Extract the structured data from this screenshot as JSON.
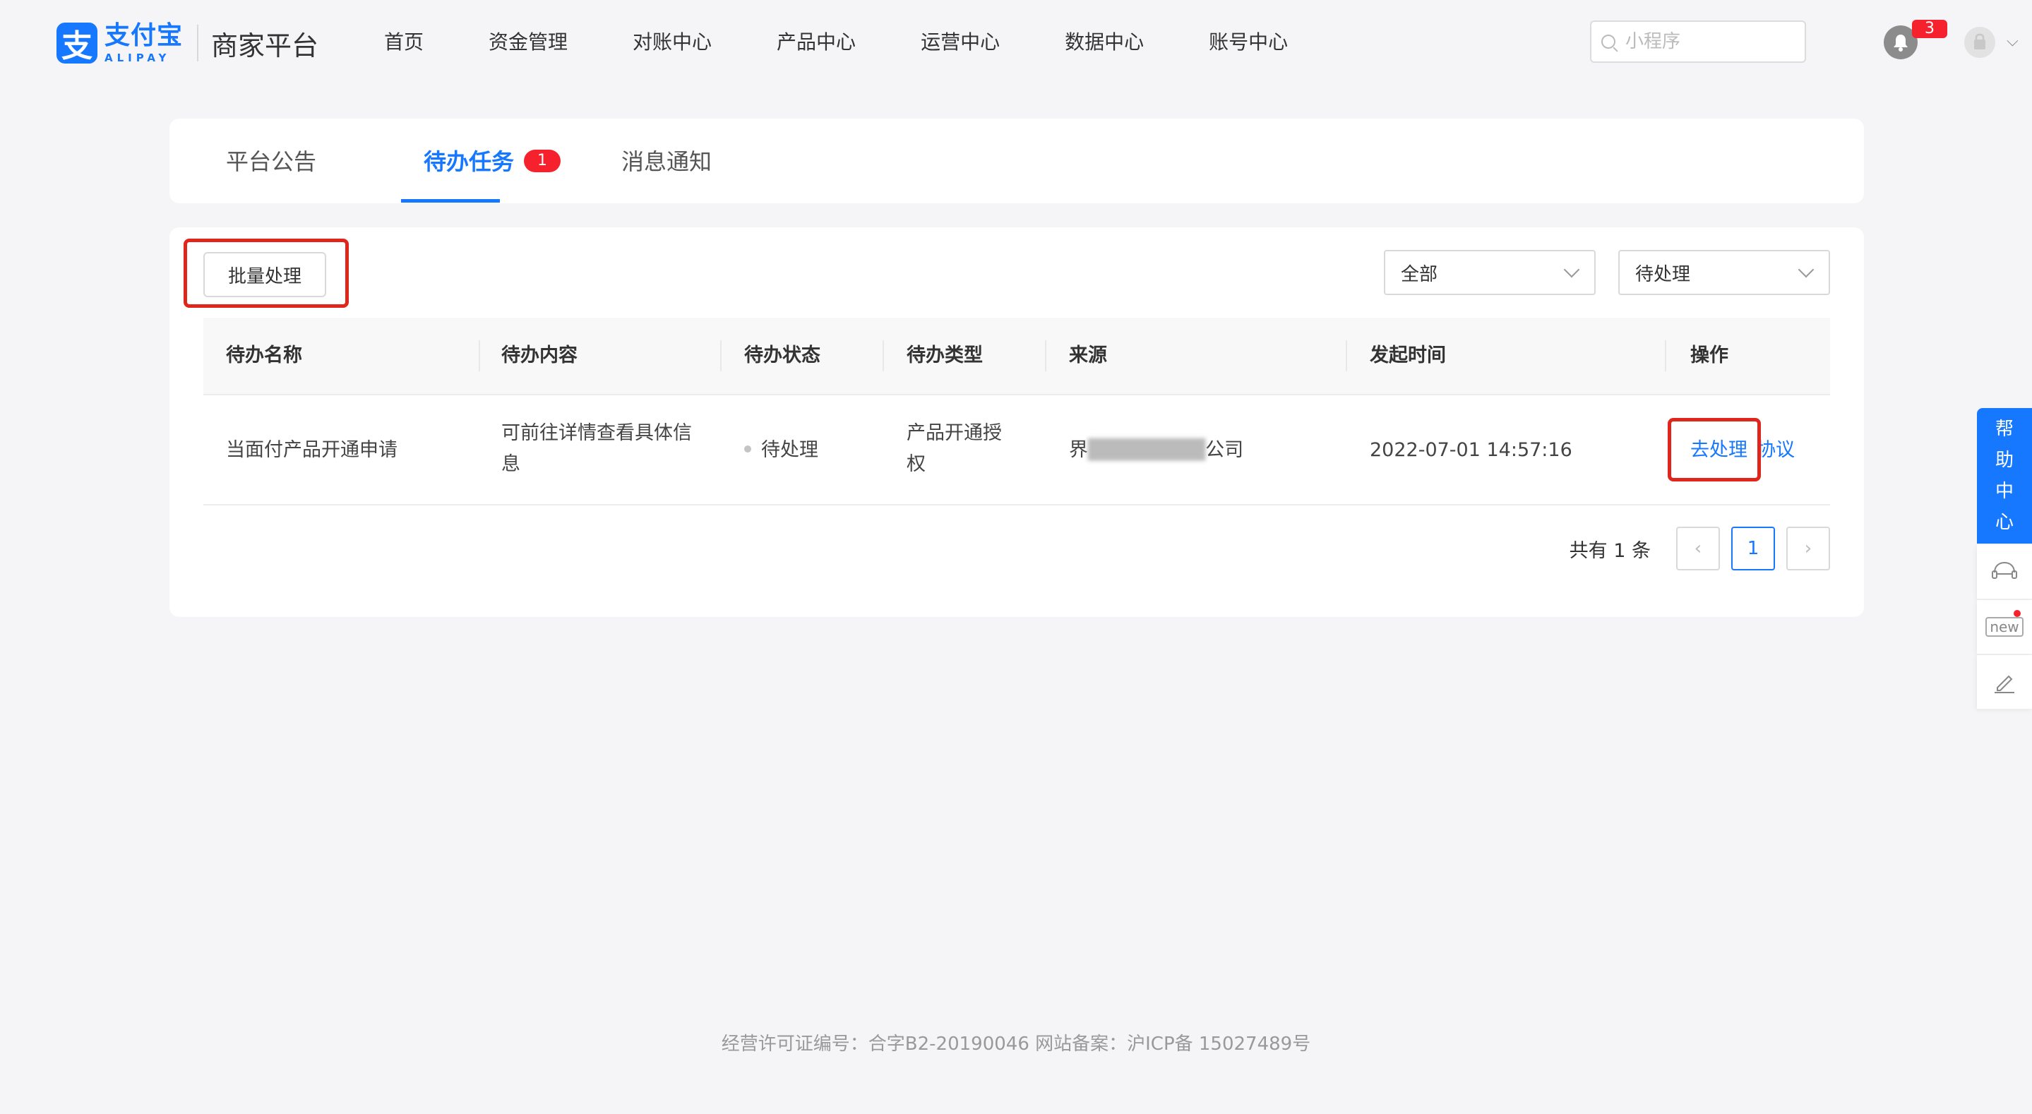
{
  "brand": {
    "logo_glyph": "支",
    "name_cn": "支付宝",
    "name_en": "ALIPAY",
    "platform": "商家平台"
  },
  "nav": [
    "首页",
    "资金管理",
    "对账中心",
    "产品中心",
    "运营中心",
    "数据中心",
    "账号中心"
  ],
  "search": {
    "placeholder": "小程序"
  },
  "notifications": {
    "count": "3"
  },
  "tabs": [
    {
      "label": "平台公告"
    },
    {
      "label": "待办任务",
      "badge": "1",
      "active": true
    },
    {
      "label": "消息通知"
    }
  ],
  "toolbar": {
    "batch_label": "批量处理",
    "filter_scope": "全部",
    "filter_status": "待处理"
  },
  "table": {
    "columns": [
      "待办名称",
      "待办内容",
      "待办状态",
      "待办类型",
      "来源",
      "发起时间",
      "操作"
    ],
    "rows": [
      {
        "name": "当面付产品开通申请",
        "content_line1": "可前往详情查看具体信",
        "content_line2": "息",
        "status": "待处理",
        "type_line1": "产品开通授",
        "type_line2": "权",
        "source_prefix": "界",
        "source_redacted": "████████",
        "source_suffix": "公司",
        "time": "2022-07-01 14:57:16",
        "action_primary": "去处理",
        "action_secondary": "协议"
      }
    ]
  },
  "pagination": {
    "total_text": "共有 1 条",
    "current_page": "1",
    "prev_icon": "‹",
    "next_icon": "›"
  },
  "footer": {
    "text": "经营许可证编号：合字B2-20190046 网站备案：沪ICP备 15027489号"
  },
  "side_float": {
    "help_chars": [
      "帮",
      "助",
      "中",
      "心"
    ],
    "new_label": "new"
  },
  "colors": {
    "accent": "#1677ff",
    "badge": "#f5222d",
    "highlight": "#e0261c"
  }
}
